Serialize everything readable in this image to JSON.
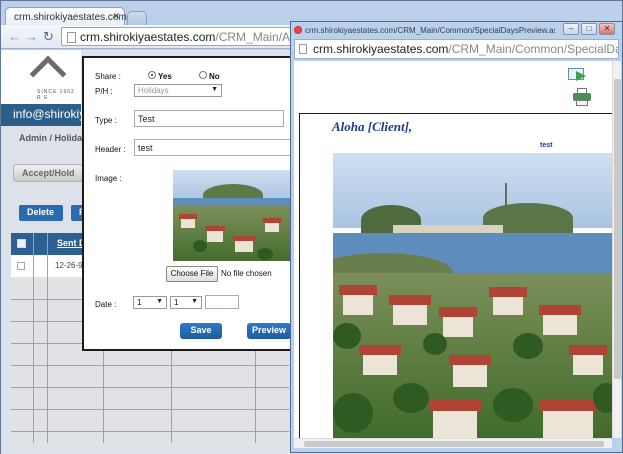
{
  "main_window": {
    "tabs": [
      {
        "title": "crm.shirokiyaestates.com/CR"
      },
      {
        "title": ""
      }
    ],
    "url_host": "crm.shirokiyaestates.com",
    "url_path": "/CRM_Main/Admin/Holi"
  },
  "background_page": {
    "logo_text": "SINCE 1962  R E",
    "email": "info@shirokiy",
    "breadcrumb": "Admin / Holiday",
    "accept_hold": "Accept/Hold",
    "delete": "Delete",
    "p_button": "F",
    "grid": {
      "sent_header": "Sent D",
      "first_date": "12-26-9"
    }
  },
  "form": {
    "share_label": "Share :",
    "share_yes": "Yes",
    "share_no": "No",
    "share_value": "Yes",
    "ph_label": "P/H :",
    "ph_value": "Holidays",
    "type_label": "Type :",
    "type_value": "Test",
    "header_label": "Header :",
    "header_value": "test",
    "image_label": "Image :",
    "choose_file": "Choose File",
    "no_file": "No file chosen",
    "date_label": "Date :",
    "date_day": "1",
    "date_month": "1",
    "date_year": "",
    "save": "Save",
    "preview": "Preview"
  },
  "popup_window": {
    "title": "crm.shirokiyaestates.com/CRM_Main/Common/SpecialDaysPreview.aspx - Google Chr",
    "url_host": "crm.shirokiyaestates.com",
    "url_path": "/CRM_Main/Common/SpecialDaysPreview.aspx",
    "greeting": "Aloha [Client],",
    "header_text": "test",
    "icons": [
      "email-forward-icon",
      "printer-icon"
    ]
  }
}
